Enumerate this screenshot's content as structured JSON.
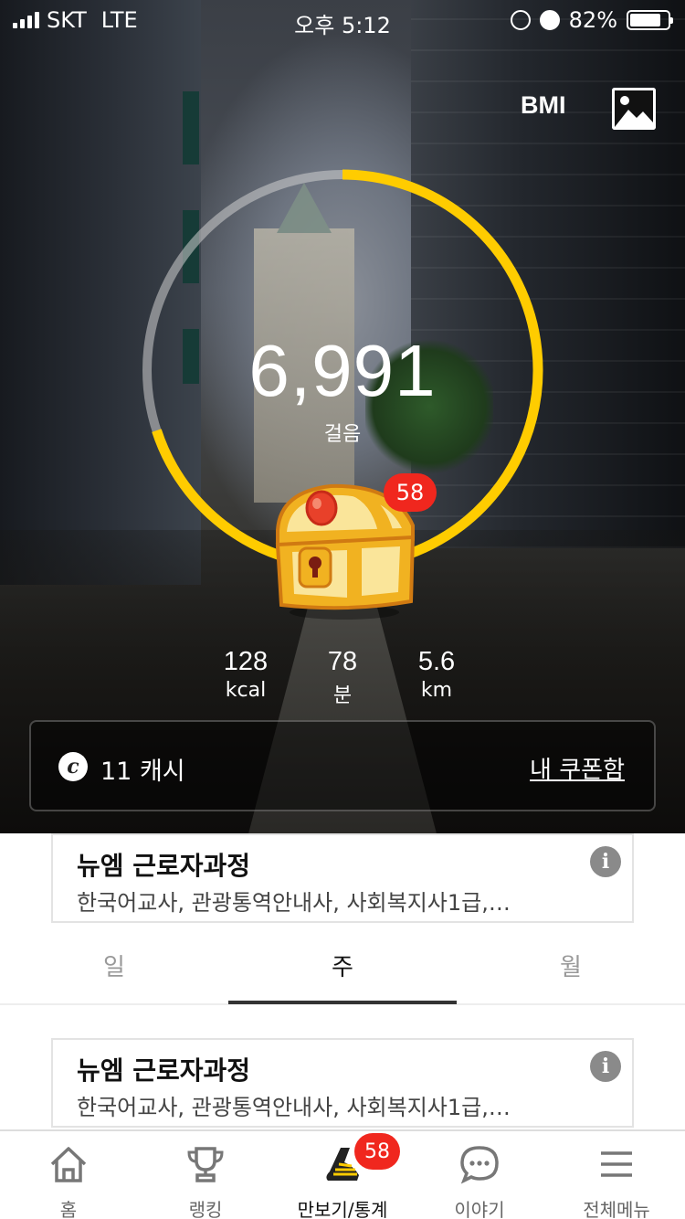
{
  "status_bar": {
    "carrier": "SKT",
    "network": "LTE",
    "time": "오후 5:12",
    "battery": "82%",
    "battery_level": 0.82
  },
  "header": {
    "bmi_label": "BMI",
    "photo_icon": "image-icon"
  },
  "progress": {
    "steps": "6,991",
    "steps_label": "걸음",
    "goal_fraction": 0.7,
    "ring_color": "#ffcc00",
    "track_color": "#cfcfcf"
  },
  "chest": {
    "icon": "treasure-chest-icon",
    "badge": "58"
  },
  "stats": [
    {
      "value": "128",
      "unit": "kcal"
    },
    {
      "value": "78",
      "unit": "분"
    },
    {
      "value": "5.6",
      "unit": "km"
    }
  ],
  "cash": {
    "icon_letter": "c",
    "amount": "11 캐시",
    "coupon_link": "내 쿠폰함"
  },
  "ads": [
    {
      "title": "뉴엠 근로자과정",
      "desc": "한국어교사, 관광통역안내사, 사회복지사1급,…",
      "info": "i"
    },
    {
      "title": "뉴엠 근로자과정",
      "desc": "한국어교사, 관광통역안내사, 사회복지사1급,…",
      "info": "i"
    }
  ],
  "tabs": [
    {
      "label": "일",
      "active": false
    },
    {
      "label": "주",
      "active": true
    },
    {
      "label": "월",
      "active": false
    }
  ],
  "bottom_nav": {
    "items": [
      {
        "label": "홈",
        "icon": "home-icon"
      },
      {
        "label": "랭킹",
        "icon": "trophy-icon"
      },
      {
        "label": "만보기/통계",
        "icon": "shoe-icon",
        "active": true
      },
      {
        "label": "이야기",
        "icon": "chat-icon"
      },
      {
        "label": "전체메뉴",
        "icon": "menu-icon"
      }
    ],
    "badge": "58"
  },
  "colors": {
    "accent": "#ffcc00",
    "badge": "#f0271e"
  }
}
